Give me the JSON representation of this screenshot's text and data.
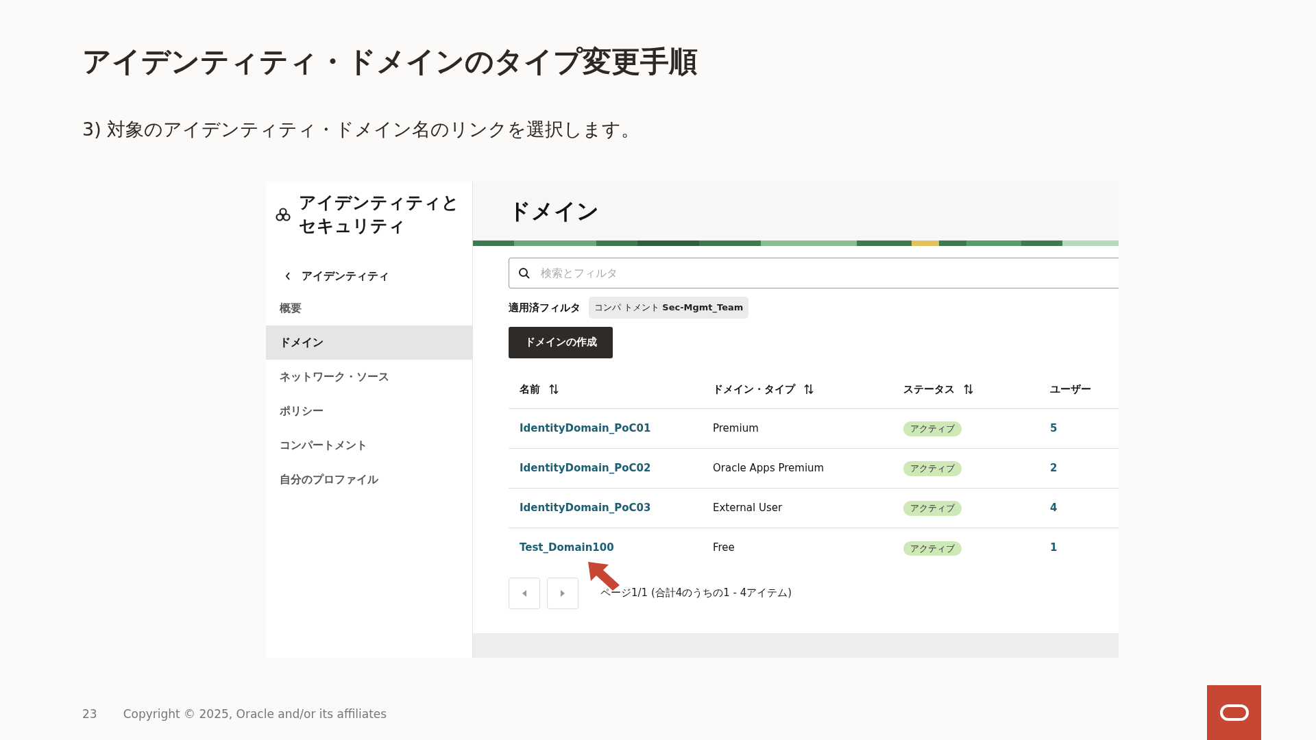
{
  "slide": {
    "title": "アイデンティティ・ドメインのタイプ変更手順",
    "step": "3) 対象のアイデンティティ・ドメイン名のリンクを選択します。",
    "page_number": "23",
    "copyright": "Copyright © 2025, Oracle and/or its affiliates"
  },
  "sidebar": {
    "title_lines": [
      "アイデンティティと",
      "セキュリティ"
    ],
    "back": "アイデンティティ",
    "items": [
      {
        "label": "概要",
        "selected": false
      },
      {
        "label": "ドメイン",
        "selected": true
      },
      {
        "label": "ネットワーク・ソース",
        "selected": false
      },
      {
        "label": "ポリシー",
        "selected": false
      },
      {
        "label": "コンパートメント",
        "selected": false
      },
      {
        "label": "自分のプロファイル",
        "selected": false
      }
    ]
  },
  "main": {
    "heading": "ドメイン",
    "search": {
      "placeholder": "検索とフィルタ"
    },
    "applied_filters_label": "適用済フィルタ",
    "filter_chip": "コンパ トメント **Sec-Mgmt_Team**",
    "create_button": "ドメインの作成",
    "table": {
      "columns": [
        {
          "label": "名前",
          "sortable": true
        },
        {
          "label": "ドメイン・タイプ",
          "sortable": true
        },
        {
          "label": "ステータス",
          "sortable": true
        },
        {
          "label": "ユーザー",
          "sortable": false
        }
      ],
      "rows": [
        {
          "name": "IdentityDomain_PoC01",
          "type": "Premium",
          "status": "アクティブ",
          "users": "5"
        },
        {
          "name": "IdentityDomain_PoC02",
          "type": "Oracle Apps Premium",
          "status": "アクティブ",
          "users": "2"
        },
        {
          "name": "IdentityDomain_PoC03",
          "type": "External User",
          "status": "アクティブ",
          "users": "4"
        },
        {
          "name": "Test_Domain100",
          "type": "Free",
          "status": "アクティブ",
          "users": "1"
        }
      ]
    },
    "pagination": "ページ1/1 (合計4のうちの1 - 4アイテム)"
  }
}
